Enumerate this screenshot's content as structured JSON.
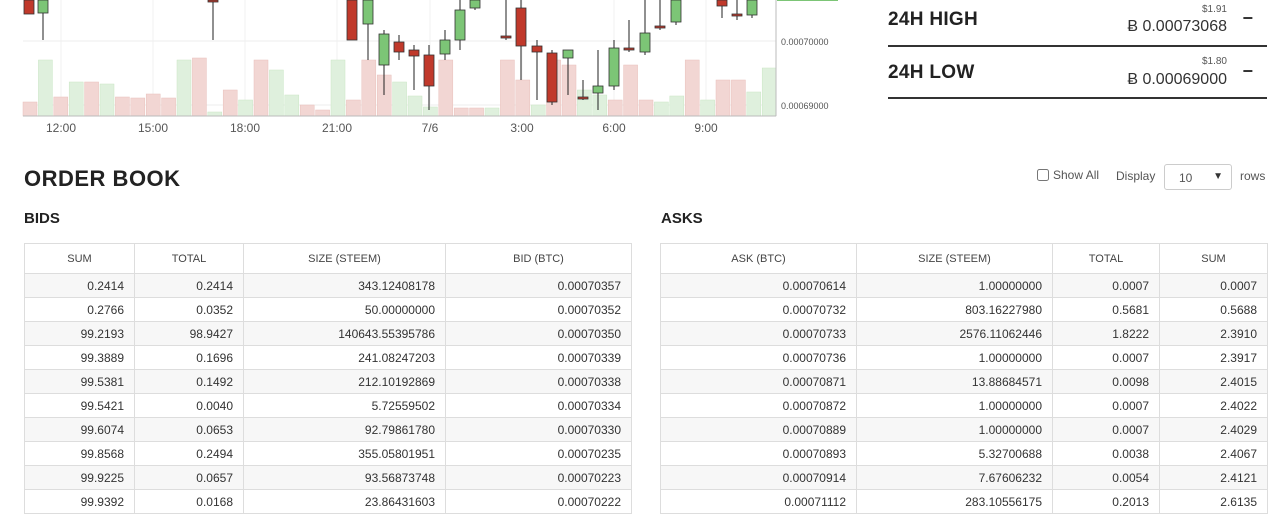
{
  "chart": {
    "price_axis_labels": [
      "0.00070000",
      "0.00069000"
    ],
    "time_axis_labels": [
      "12:00",
      "15:00",
      "18:00",
      "21:00",
      "7/6",
      "3:00",
      "6:00",
      "9:00"
    ],
    "colors": {
      "up": "#7cc576",
      "down": "#c0392b",
      "vol_up": "#dff0dd",
      "vol_down": "#f2d6d3",
      "line": "#7cc576"
    }
  },
  "stats": [
    {
      "label": "24H HIGH",
      "usd": "$1.91",
      "btc": "Ƀ 0.00073068",
      "toggle": "−"
    },
    {
      "label": "24H LOW",
      "usd": "$1.80",
      "btc": "Ƀ 0.00069000",
      "toggle": "−"
    }
  ],
  "order_book": {
    "title": "ORDER BOOK",
    "show_all_label": "Show All",
    "display_label": "Display",
    "display_value": "10",
    "rows_label": "rows",
    "bids": {
      "title": "BIDS",
      "headers": [
        "SUM",
        "TOTAL",
        "SIZE (STEEM)",
        "BID (BTC)"
      ],
      "rows": [
        [
          "0.2414",
          "0.2414",
          "343.12408178",
          "0.00070357"
        ],
        [
          "0.2766",
          "0.0352",
          "50.00000000",
          "0.00070352"
        ],
        [
          "99.2193",
          "98.9427",
          "140643.55395786",
          "0.00070350"
        ],
        [
          "99.3889",
          "0.1696",
          "241.08247203",
          "0.00070339"
        ],
        [
          "99.5381",
          "0.1492",
          "212.10192869",
          "0.00070338"
        ],
        [
          "99.5421",
          "0.0040",
          "5.72559502",
          "0.00070334"
        ],
        [
          "99.6074",
          "0.0653",
          "92.79861780",
          "0.00070330"
        ],
        [
          "99.8568",
          "0.2494",
          "355.05801951",
          "0.00070235"
        ],
        [
          "99.9225",
          "0.0657",
          "93.56873748",
          "0.00070223"
        ],
        [
          "99.9392",
          "0.0168",
          "23.86431603",
          "0.00070222"
        ]
      ]
    },
    "asks": {
      "title": "ASKS",
      "headers": [
        "ASK (BTC)",
        "SIZE (STEEM)",
        "TOTAL",
        "SUM"
      ],
      "rows": [
        [
          "0.00070614",
          "1.00000000",
          "0.0007",
          "0.0007"
        ],
        [
          "0.00070732",
          "803.16227980",
          "0.5681",
          "0.5688"
        ],
        [
          "0.00070733",
          "2576.11062446",
          "1.8222",
          "2.3910"
        ],
        [
          "0.00070736",
          "1.00000000",
          "0.0007",
          "2.3917"
        ],
        [
          "0.00070871",
          "13.88684571",
          "0.0098",
          "2.4015"
        ],
        [
          "0.00070872",
          "1.00000000",
          "0.0007",
          "2.4022"
        ],
        [
          "0.00070889",
          "1.00000000",
          "0.0007",
          "2.4029"
        ],
        [
          "0.00070893",
          "5.32700688",
          "0.0038",
          "2.4067"
        ],
        [
          "0.00070914",
          "7.67606232",
          "0.0054",
          "2.4121"
        ],
        [
          "0.00071112",
          "283.10556175",
          "0.2013",
          "2.6135"
        ]
      ]
    }
  }
}
